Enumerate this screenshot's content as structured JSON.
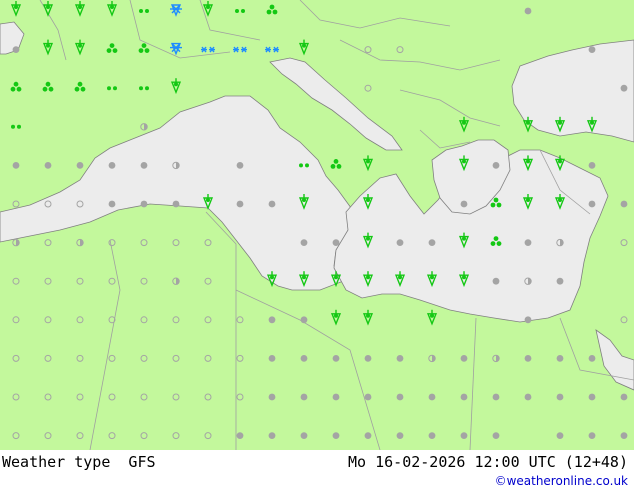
{
  "title_left": "Weather type  GFS",
  "title_right": "Mo 16-02-2026 12:00 UTC (12+48)",
  "credit": "©weatheronline.co.uk",
  "colors": {
    "land": "#c3f89c",
    "sea": "#ececec",
    "border": "#a0a0a0",
    "coast": "#808080",
    "dot": "#a4a4a4",
    "rain": "#14c814",
    "snow": "#1e8cff"
  },
  "grid": {
    "columns": 20,
    "rows": 12
  },
  "symbols": {
    "legend_codes": {
      "d": "cloudy (filled dot)",
      "o": "clear (open circle)",
      "h": "partly cloudy (half dot)",
      "r": "rain showers",
      "t": "rain",
      "w": "drizzle",
      "s": "snow",
      "m": "snow showers"
    },
    "rows": [
      "rrrrwmrwt.......d...",
      "drrttmsssr.oo.....d.",
      "tttwwr.....o.......d",
      "w...h.........r.rrr.",
      "dddddh.d.wtr..rdrrd.",
      "ooodddrddr.r..dtrrdd",
      "hohoooo..ddrddrtdh.o",
      "oooooho.rrrrrrrdhd..",
      "ooooooooddrr.r..d..o",
      "oooooooodddddhdhddd.",
      "oooooooodddddddddddd",
      "oooooooddddddddd.ddd"
    ]
  }
}
